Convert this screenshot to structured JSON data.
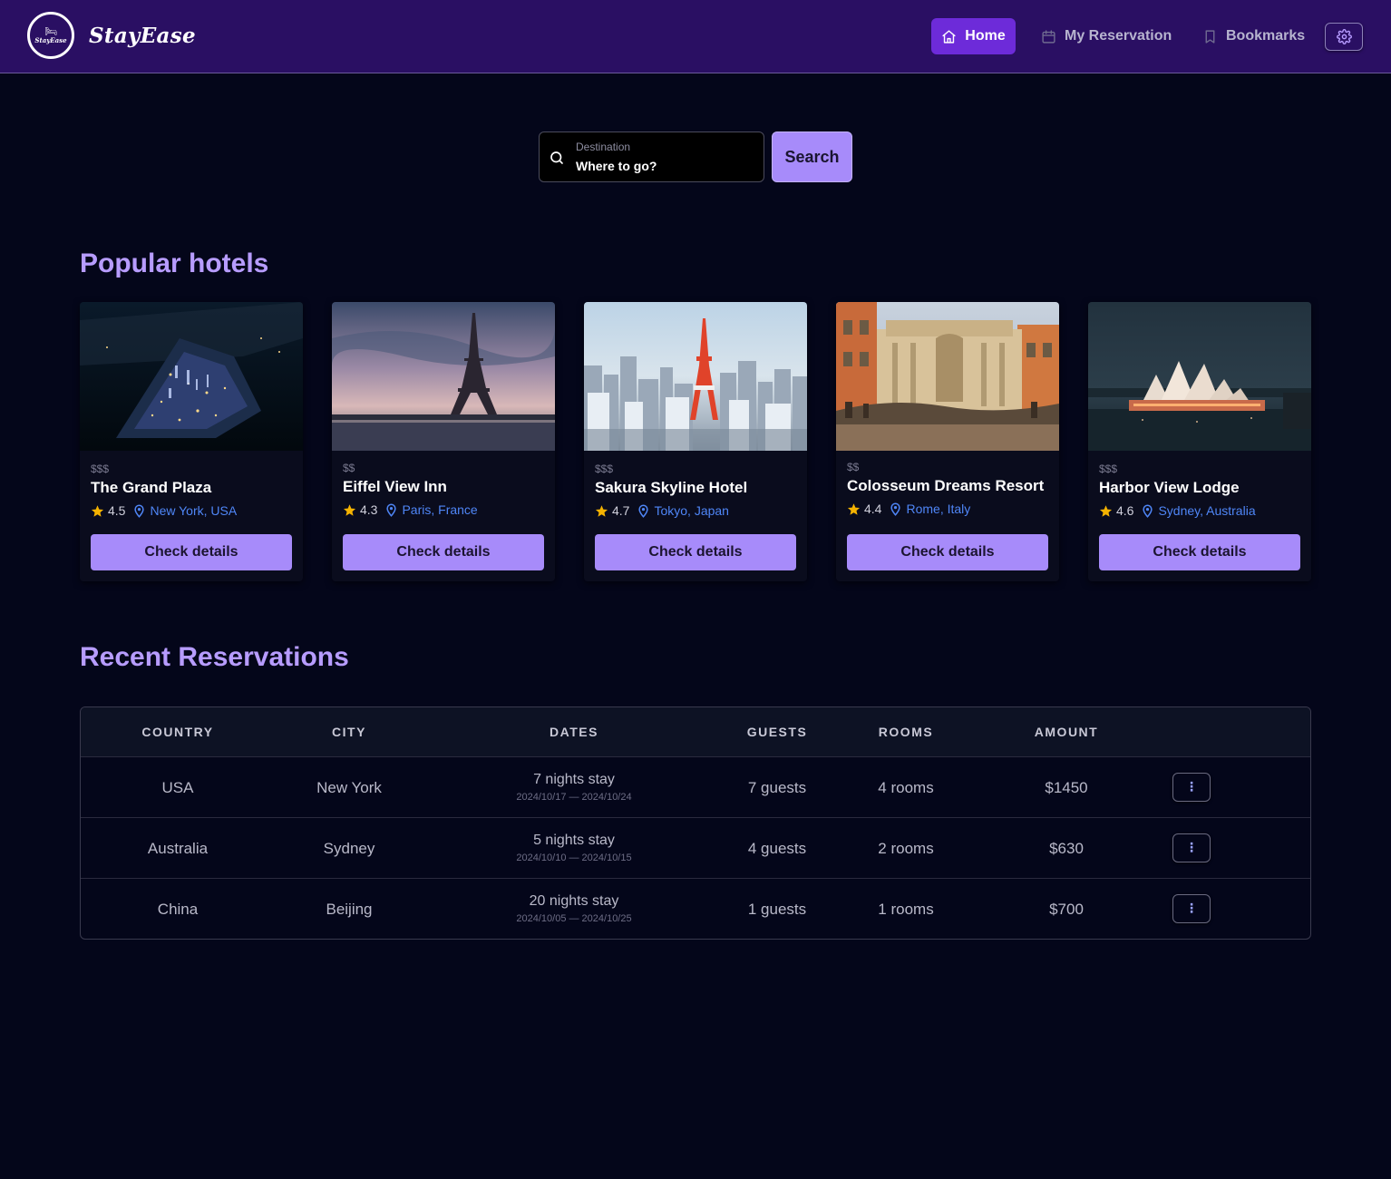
{
  "brand": {
    "name": "StayEase",
    "logo_text": "StayEase"
  },
  "nav": {
    "home": "Home",
    "reservation": "My Reservation",
    "bookmarks": "Bookmarks"
  },
  "search": {
    "label": "Destination",
    "placeholder": "Where to go?",
    "button": "Search"
  },
  "popular": {
    "title": "Popular hotels",
    "hotels": [
      {
        "price": "$$$",
        "name": "The Grand Plaza",
        "rating": "4.5",
        "location": "New York, USA",
        "button": "Check details"
      },
      {
        "price": "$$",
        "name": "Eiffel View Inn",
        "rating": "4.3",
        "location": "Paris, France",
        "button": "Check details"
      },
      {
        "price": "$$$",
        "name": "Sakura Skyline Hotel",
        "rating": "4.7",
        "location": "Tokyo, Japan",
        "button": "Check details"
      },
      {
        "price": "$$",
        "name": "Colosseum Dreams Resort",
        "rating": "4.4",
        "location": "Rome, Italy",
        "button": "Check details"
      },
      {
        "price": "$$$",
        "name": "Harbor View Lodge",
        "rating": "4.6",
        "location": "Sydney, Australia",
        "button": "Check details"
      }
    ]
  },
  "reservations": {
    "title": "Recent Reservations",
    "headers": [
      "COUNTRY",
      "CITY",
      "DATES",
      "GUESTS",
      "ROOMS",
      "AMOUNT"
    ],
    "rows": [
      {
        "country": "USA",
        "city": "New York",
        "nights": "7 nights stay",
        "range": "2024/10/17 — 2024/10/24",
        "guests": "7 guests",
        "rooms": "4 rooms",
        "amount": "$1450",
        "menu": "⋮"
      },
      {
        "country": "Australia",
        "city": "Sydney",
        "nights": "5 nights stay",
        "range": "2024/10/10 — 2024/10/15",
        "guests": "4 guests",
        "rooms": "2 rooms",
        "amount": "$630",
        "menu": "⋮"
      },
      {
        "country": "China",
        "city": "Beijing",
        "nights": "20 nights stay",
        "range": "2024/10/05 — 2024/10/25",
        "guests": "1 guests",
        "rooms": "1 rooms",
        "amount": "$700",
        "menu": "⋮"
      }
    ]
  },
  "colors": {
    "background": "#04061a",
    "navbar": "#2a0f63",
    "nav_active": "#6d2bd9",
    "accent": "#a78bfa",
    "title": "#b79cff",
    "location": "#4f86f7",
    "star": "#f5b301"
  },
  "icons": {
    "home": "home-icon",
    "reservation": "calendar-icon",
    "bookmarks": "bookmark-icon",
    "settings": "gear-icon",
    "search": "search-icon",
    "rating": "star-icon",
    "location": "map-pin-icon",
    "row_menu": "vertical-dots-icon"
  }
}
